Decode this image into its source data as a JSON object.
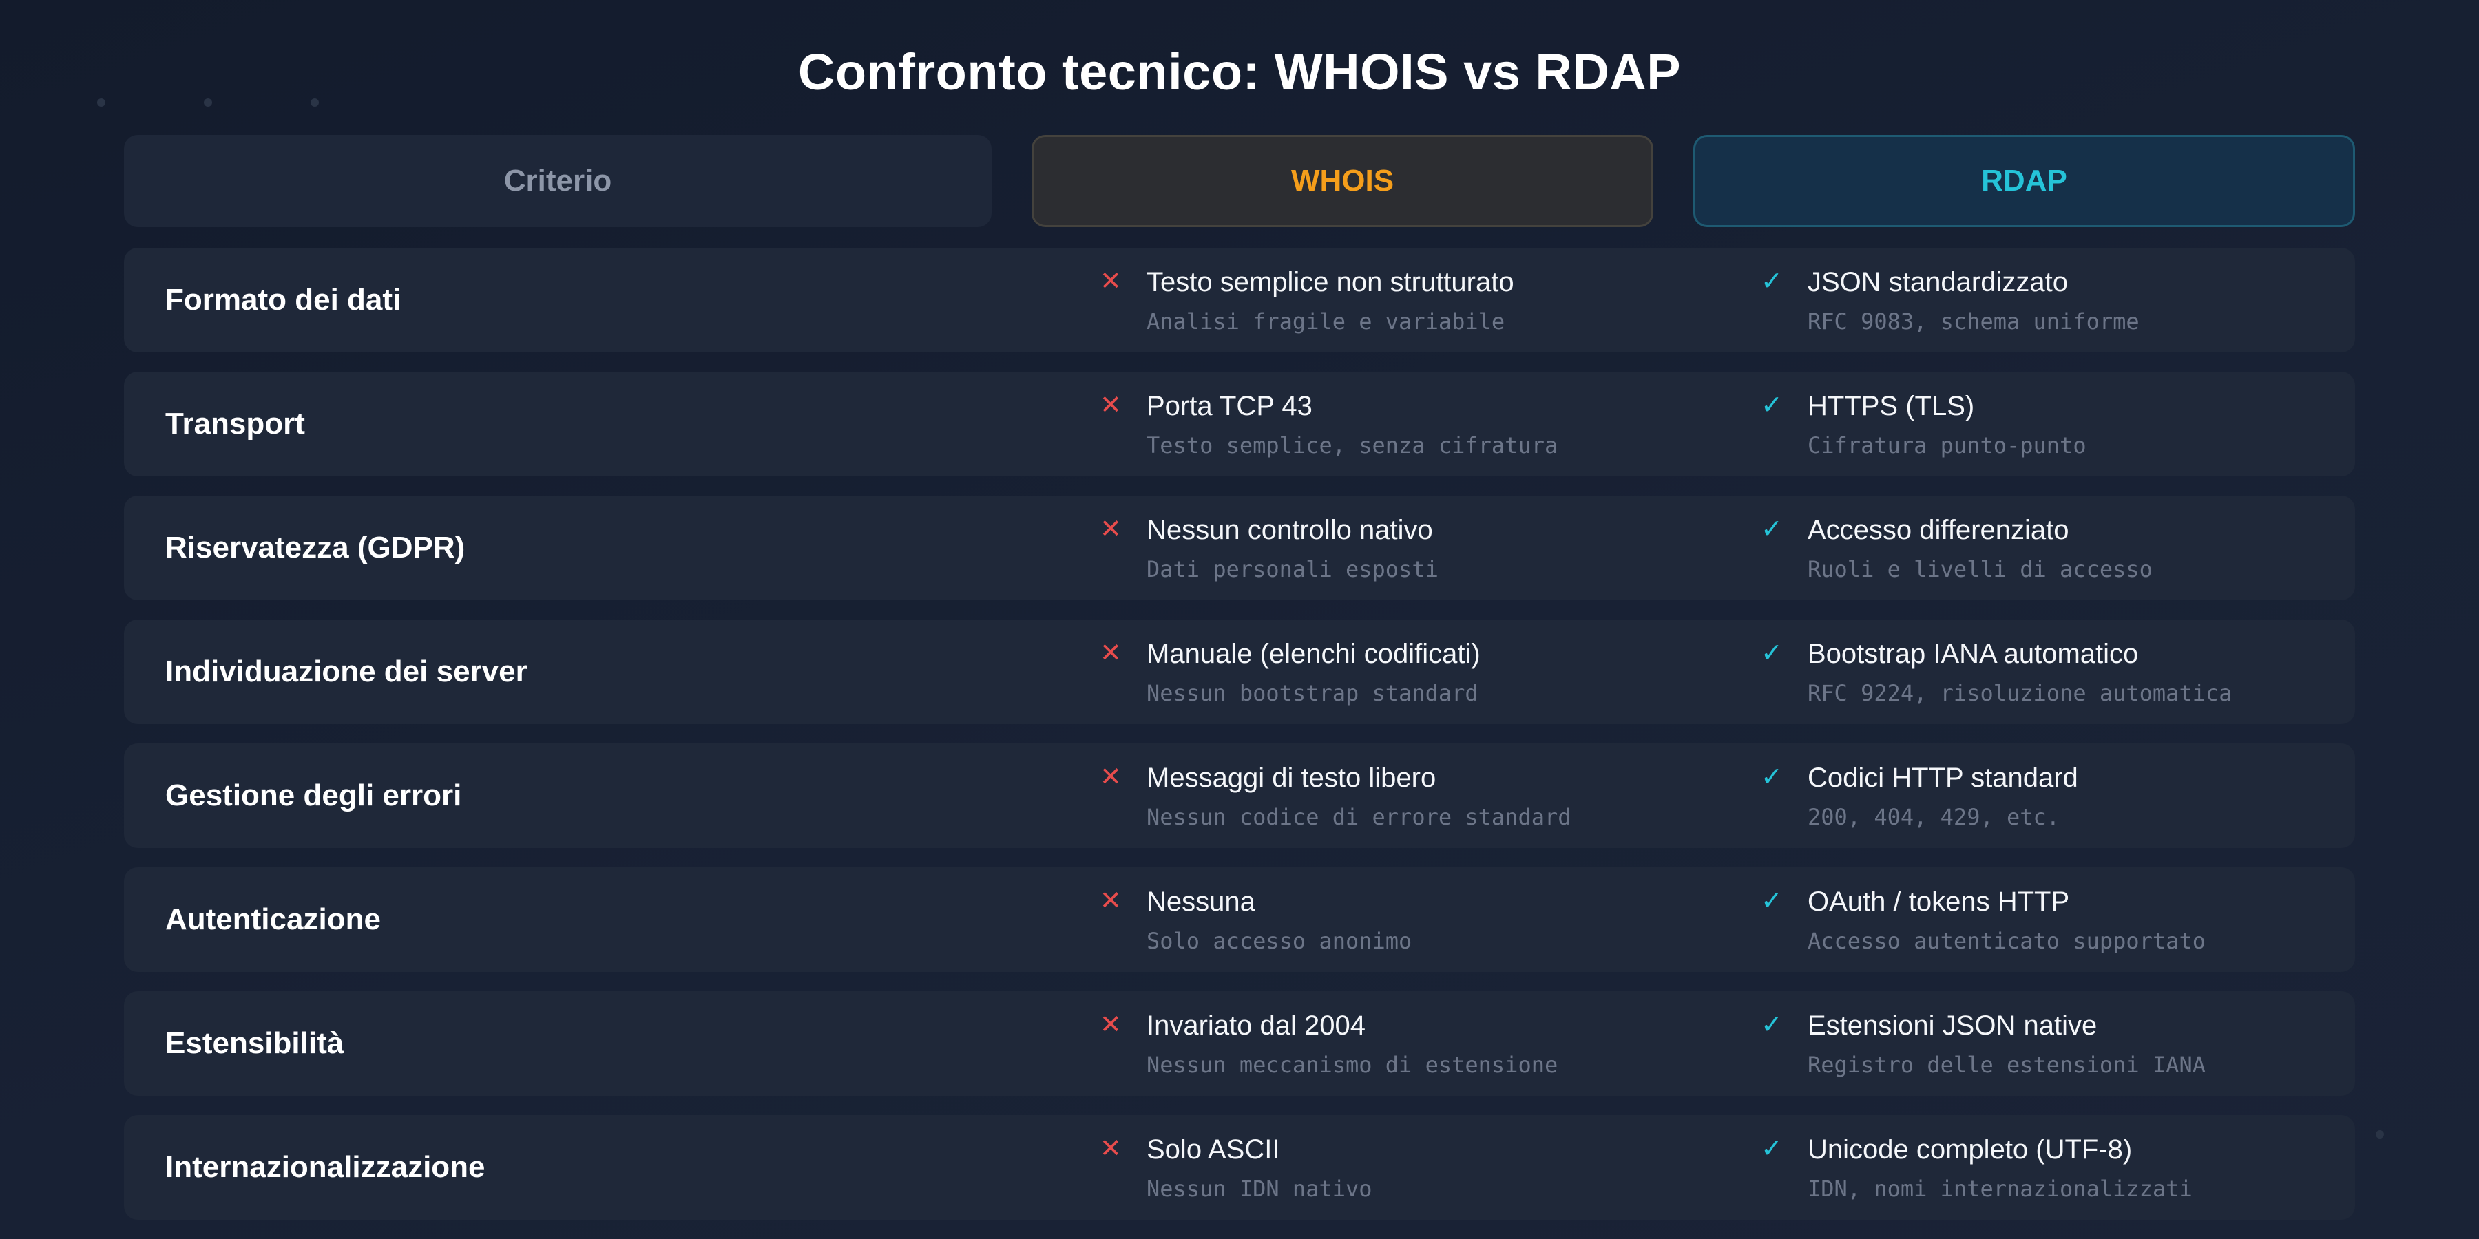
{
  "title": "Confronto tecnico: WHOIS vs RDAP",
  "headers": {
    "criterion": "Criterio",
    "whois": "WHOIS",
    "rdap": "RDAP"
  },
  "colors": {
    "whois_accent": "#f59e1b",
    "rdap_accent": "#25c3d8",
    "negative": "#e74c4c",
    "background": "#131b2c"
  },
  "icons": {
    "whois": "x-icon",
    "rdap": "check-icon"
  },
  "rows": [
    {
      "criterion": "Formato dei dati",
      "whois": {
        "main": "Testo semplice non strutturato",
        "sub": "Analisi fragile e variabile"
      },
      "rdap": {
        "main": "JSON standardizzato",
        "sub": "RFC 9083, schema uniforme"
      }
    },
    {
      "criterion": "Transport",
      "whois": {
        "main": "Porta TCP 43",
        "sub": "Testo semplice, senza cifratura"
      },
      "rdap": {
        "main": "HTTPS (TLS)",
        "sub": "Cifratura punto-punto"
      }
    },
    {
      "criterion": "Riservatezza (GDPR)",
      "whois": {
        "main": "Nessun controllo nativo",
        "sub": "Dati personali esposti"
      },
      "rdap": {
        "main": "Accesso differenziato",
        "sub": "Ruoli e livelli di accesso"
      }
    },
    {
      "criterion": "Individuazione dei server",
      "whois": {
        "main": "Manuale (elenchi codificati)",
        "sub": "Nessun bootstrap standard"
      },
      "rdap": {
        "main": "Bootstrap IANA automatico",
        "sub": "RFC 9224, risoluzione automatica"
      }
    },
    {
      "criterion": "Gestione degli errori",
      "whois": {
        "main": "Messaggi di testo libero",
        "sub": "Nessun codice di errore standard"
      },
      "rdap": {
        "main": "Codici HTTP standard",
        "sub": "200, 404, 429, etc."
      }
    },
    {
      "criterion": "Autenticazione",
      "whois": {
        "main": "Nessuna",
        "sub": "Solo accesso anonimo"
      },
      "rdap": {
        "main": "OAuth / tokens HTTP",
        "sub": "Accesso autenticato supportato"
      }
    },
    {
      "criterion": "Estensibilità",
      "whois": {
        "main": "Invariato dal 2004",
        "sub": "Nessun meccanismo di estensione"
      },
      "rdap": {
        "main": "Estensioni JSON native",
        "sub": "Registro delle estensioni IANA"
      }
    },
    {
      "criterion": "Internazionalizzazione",
      "whois": {
        "main": "Solo ASCII",
        "sub": "Nessun IDN nativo"
      },
      "rdap": {
        "main": "Unicode completo (UTF-8)",
        "sub": "IDN, nomi internazionalizzati"
      }
    }
  ]
}
